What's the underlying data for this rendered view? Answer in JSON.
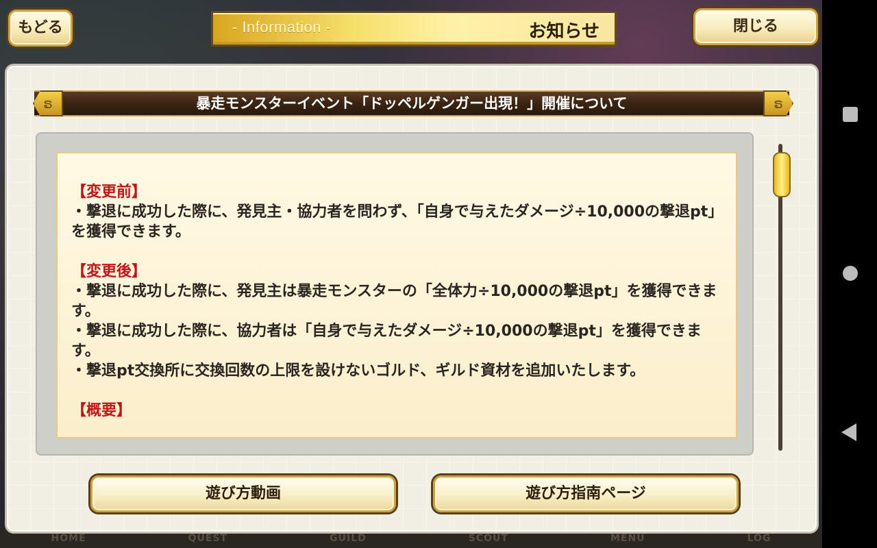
{
  "header": {
    "back_label": "もどる",
    "title_en": "- Information -",
    "title_ja": "お知らせ",
    "close_label": "閉じる"
  },
  "announcement": {
    "title": "暴走モンスターイベント「ドッペルゲンガー出現！」開催について",
    "sections": [
      {
        "heading": "【変更前】",
        "paragraphs": [
          "・撃退に成功した際に、発見主・協力者を問わず、「自身で与えたダメージ÷10,000の撃退pt」を獲得できます。"
        ]
      },
      {
        "heading": "【変更後】",
        "paragraphs": [
          "・撃退に成功した際に、発見主は暴走モンスターの「全体力÷10,000の撃退pt」を獲得できます。",
          "・撃退に成功した際に、協力者は「自身で与えたダメージ÷10,000の撃退pt」を獲得できます。",
          "・撃退pt交換所に交換回数の上限を設けないゴルド、ギルド資材を追加いたします。"
        ]
      },
      {
        "heading": "【概要】",
        "paragraphs": []
      }
    ]
  },
  "buttons": {
    "video": "遊び方動画",
    "guide": "遊び方指南ページ"
  },
  "bottom_tabs": [
    "HOME",
    "QUEST",
    "GUILD",
    "SCOUT",
    "MENU",
    "LOG"
  ],
  "colors": {
    "heading_red": "#c0151a",
    "gold": "#f6df6a",
    "dark_brown": "#3a2412"
  },
  "icons": {
    "ornament": "swirl-ornament-icon",
    "nav_recents": "square-icon",
    "nav_home": "circle-icon",
    "nav_back": "triangle-back-icon"
  }
}
